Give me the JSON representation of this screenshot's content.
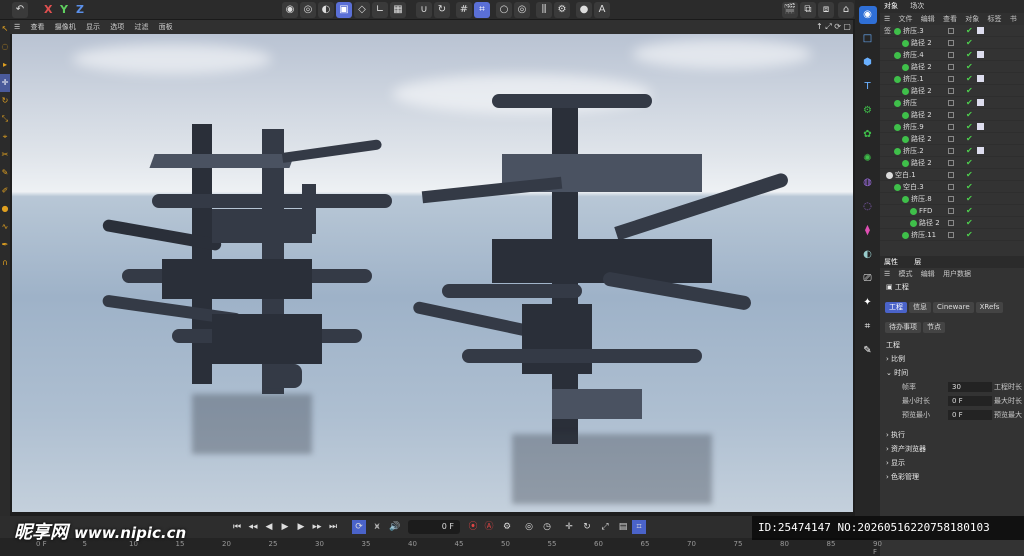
{
  "topbar": {
    "axes": [
      "X",
      "Y",
      "Z"
    ]
  },
  "viewport_menu": [
    "查看",
    "摄像机",
    "显示",
    "选项",
    "过滤",
    "面板"
  ],
  "object_manager": {
    "tabs": [
      "对象",
      "场次"
    ],
    "menu": [
      "文件",
      "编辑",
      "查看",
      "对象",
      "标签",
      "书签"
    ],
    "rows": [
      {
        "name": "挤压.3",
        "indent": 1
      },
      {
        "name": "路径 2",
        "indent": 2
      },
      {
        "name": "挤压.4",
        "indent": 1
      },
      {
        "name": "路径 2",
        "indent": 2
      },
      {
        "name": "挤压.1",
        "indent": 1
      },
      {
        "name": "路径 2",
        "indent": 2
      },
      {
        "name": "挤压",
        "indent": 1
      },
      {
        "name": "路径 2",
        "indent": 2
      },
      {
        "name": "挤压.9",
        "indent": 1
      },
      {
        "name": "路径 2",
        "indent": 2
      },
      {
        "name": "挤压.2",
        "indent": 1
      },
      {
        "name": "路径 2",
        "indent": 2
      },
      {
        "name": "空白.1",
        "indent": 0
      },
      {
        "name": "空白.3",
        "indent": 1
      },
      {
        "name": "挤压.8",
        "indent": 2
      },
      {
        "name": "FFD",
        "indent": 3
      },
      {
        "name": "路径 2",
        "indent": 3
      },
      {
        "name": "挤压.11",
        "indent": 2
      }
    ]
  },
  "attributes": {
    "tabs": [
      "属性",
      "层"
    ],
    "menu": [
      "模式",
      "编辑",
      "用户数据"
    ],
    "title": "工程",
    "chips": [
      "工程",
      "信息",
      "Cineware",
      "XRefs",
      "待办事项",
      "节点"
    ],
    "section": "工程",
    "groups": [
      "比例",
      "时间",
      "执行",
      "资产浏览器",
      "显示",
      "色彩管理"
    ],
    "fields": [
      {
        "label": "帧率",
        "value": "30",
        "label2": "工程时长"
      },
      {
        "label": "最小时长",
        "value": "0 F",
        "label2": "最大时长"
      },
      {
        "label": "预览最小",
        "value": "0 F",
        "label2": "预览最大"
      }
    ]
  },
  "timeline": {
    "frame": "0 F",
    "ruler": [
      "0 F",
      "5",
      "10",
      "15",
      "20",
      "25",
      "30",
      "35",
      "40",
      "45",
      "50",
      "55",
      "60",
      "65",
      "70",
      "75",
      "80",
      "85",
      "90 F"
    ]
  },
  "watermark": {
    "logo": "昵享网",
    "url": "www.nipic.cn",
    "id": "ID:25474147 NO:20260516220758180103"
  }
}
